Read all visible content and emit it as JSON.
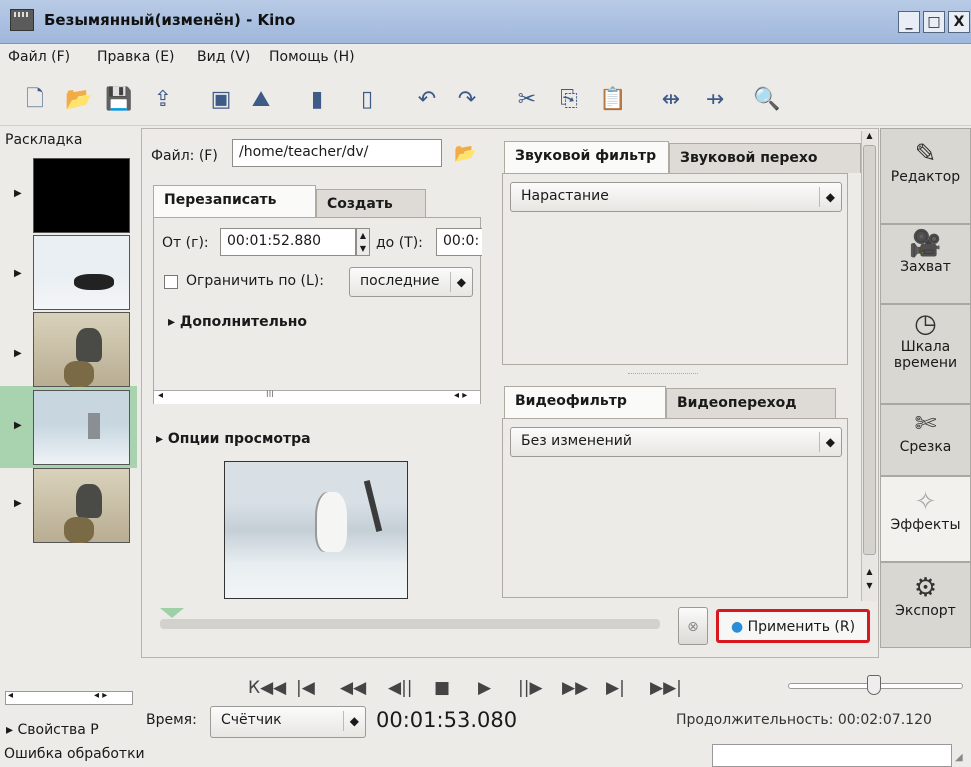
{
  "window": {
    "title": "Безымянный(изменён) - Kino",
    "minimize": "_",
    "maximize": "□",
    "close": "X"
  },
  "menu": {
    "items": [
      "Файл (F)",
      "Правка (E)",
      "Вид (V)",
      "Помощь (H)"
    ]
  },
  "toolbar": {
    "icons": [
      "new-icon",
      "open-icon",
      "save-icon",
      "export-icon",
      "capture-icon",
      "image-icon",
      "film-icon",
      "film-add-icon",
      "undo-icon",
      "redo-icon",
      "cut-icon",
      "copy-icon",
      "paste-icon",
      "split-icon",
      "join-icon",
      "zoom-icon"
    ]
  },
  "storyboard": {
    "title": "Раскладка"
  },
  "file": {
    "label": "Файл: (F)",
    "path": "/home/teacher/dv/"
  },
  "tabs_left": {
    "overwrite": "Перезаписать",
    "create": "Создать"
  },
  "range": {
    "from_label": "От (г):",
    "from_value": "00:01:52.880",
    "to_label": "до (T):",
    "to_value": "00:0:"
  },
  "limit": {
    "label": "Ограничить по (L):",
    "option": "последние"
  },
  "advanced": "Дополнительно",
  "preview_options": "Опции просмотра",
  "audio": {
    "tab_filter": "Звуковой фильтр",
    "tab_transition": "Звуковой перехо",
    "filter_value": "Нарастание"
  },
  "video": {
    "tab_filter": "Видеофильтр",
    "tab_transition": "Видеопереход",
    "filter_value": "Без изменений"
  },
  "apply_button": "Применить (R)",
  "side": {
    "editor": "Редактор",
    "capture": "Захват",
    "timeline_1": "Шкала",
    "timeline_2": "времени",
    "trim": "Срезка",
    "effects": "Эффекты",
    "export": "Экспорт"
  },
  "transport": {
    "buttons": [
      "К◀◀",
      "|◀",
      "◀◀",
      "◀||",
      "■",
      "▶",
      "||▶",
      "▶▶",
      "▶|",
      "▶▶|"
    ]
  },
  "status": {
    "properties": "Свойства P",
    "time_label": "Время:",
    "time_mode": "Счётчик",
    "time_value": "00:01:53.080",
    "duration": "Продолжительность: 00:02:07.120",
    "error": "Ошибка обработки"
  },
  "colors": {
    "titlebar": "#a9bfe0",
    "highlight_red": "#d9171e",
    "selected_row": "#a9d3ae"
  }
}
